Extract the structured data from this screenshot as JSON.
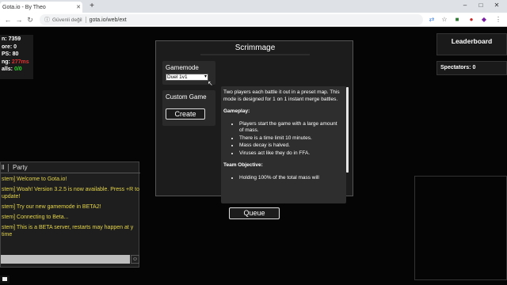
{
  "browser": {
    "tab_title": "Gota.io - By Theo",
    "tab_close": "✕",
    "new_tab": "+",
    "minimize": "–",
    "maximize": "□",
    "close": "✕",
    "back": "←",
    "forward": "→",
    "reload": "↻",
    "insecure_label": "Güvenli değil",
    "url": "gota.io/web/ext",
    "icons": [
      "translate-icon",
      "star-icon",
      "extension-icon",
      "profile-icon",
      "menu-icon"
    ],
    "accent": "#dee1e6"
  },
  "stats": {
    "score": "7359",
    "score_prefix": "n: ",
    "lines": [
      {
        "prefix": "ore: ",
        "value": "0",
        "color": "white"
      },
      {
        "prefix": "PS: ",
        "value": "80",
        "color": "white"
      },
      {
        "prefix": "ng: ",
        "value": "277ms",
        "color": "red"
      },
      {
        "prefix": "alls: ",
        "value": "0/0",
        "color": "green"
      }
    ]
  },
  "leaderboard": {
    "title": "Leaderboard",
    "spectators_label": "Spectators: 0"
  },
  "chat": {
    "tab_all": "ll",
    "tab_party": "Party",
    "messages": [
      "stem] Welcome to Gota.io!",
      "stem] Woah! Version 3.2.5 is now available. Press +R to update!",
      "stem] Try our new gamemode in BETA2!",
      "stem] Connecting to Beta...",
      "stem] This is a BETA server, restarts may happen at y time"
    ],
    "message_color": "#e5d54a"
  },
  "modal": {
    "title": "Scrimmage",
    "gamemode_label": "Gamemode",
    "gamemode_value": "Duel 1v1",
    "custom_game_label": "Custom Game",
    "create_label": "Create",
    "queue_label": "Queue",
    "info": {
      "intro": "Two players each battle it out in a preset map. This mode is designed for 1 on 1 instant merge battles.",
      "gameplay_heading": "Gameplay:",
      "gameplay_items": [
        "Players start the game with a large amount of mass.",
        "There is a time limit 10 minutes.",
        "Mass decay is halved.",
        "Viruses act like they do in FFA."
      ],
      "objective_heading": "Team Objective:",
      "objective_items": [
        "Holding 100% of the total mass will"
      ]
    }
  }
}
